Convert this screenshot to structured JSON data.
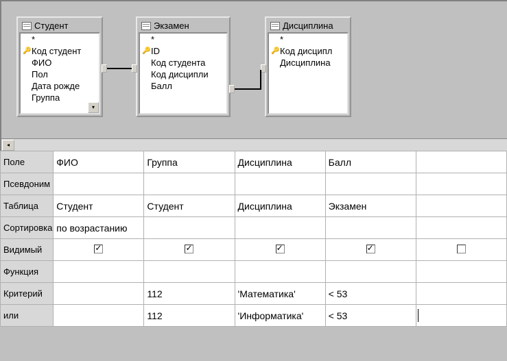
{
  "tables": [
    {
      "title": "Студент",
      "fields": [
        {
          "key": false,
          "label": "*"
        },
        {
          "key": true,
          "label": "Код студент"
        },
        {
          "key": false,
          "label": "ФИО"
        },
        {
          "key": false,
          "label": "Пол"
        },
        {
          "key": false,
          "label": "Дата рожде"
        },
        {
          "key": false,
          "label": "Группа"
        }
      ],
      "scrollable": true
    },
    {
      "title": "Экзамен",
      "fields": [
        {
          "key": false,
          "label": "*"
        },
        {
          "key": true,
          "label": "ID"
        },
        {
          "key": false,
          "label": "Код студента"
        },
        {
          "key": false,
          "label": "Код дисципли"
        },
        {
          "key": false,
          "label": "Балл"
        }
      ],
      "scrollable": false
    },
    {
      "title": "Дисциплина",
      "fields": [
        {
          "key": false,
          "label": "*"
        },
        {
          "key": true,
          "label": "Код дисципл"
        },
        {
          "key": false,
          "label": "Дисциплина"
        }
      ],
      "scrollable": false
    }
  ],
  "grid": {
    "rowLabels": {
      "field": "Поле",
      "alias": "Псевдоним",
      "table": "Таблица",
      "sort": "Сортировка",
      "visible": "Видимый",
      "func": "Функция",
      "criteria": "Критерий",
      "or": "или"
    },
    "columns": [
      {
        "field": "ФИО",
        "alias": "",
        "table": "Студент",
        "sort": "по возрастанию",
        "visible": true,
        "func": "",
        "criteria": "",
        "or": ""
      },
      {
        "field": "Группа",
        "alias": "",
        "table": "Студент",
        "sort": "",
        "visible": true,
        "func": "",
        "criteria": "112",
        "or": "112"
      },
      {
        "field": "Дисциплина",
        "alias": "",
        "table": "Дисциплина",
        "sort": "",
        "visible": true,
        "func": "",
        "criteria": "'Математика'",
        "or": "'Информатика'"
      },
      {
        "field": "Балл",
        "alias": "",
        "table": "Экзамен",
        "sort": "",
        "visible": true,
        "func": "",
        "criteria": "< 53",
        "or": "< 53"
      },
      {
        "field": "",
        "alias": "",
        "table": "",
        "sort": "",
        "visible": false,
        "func": "",
        "criteria": "",
        "or": ""
      }
    ]
  }
}
